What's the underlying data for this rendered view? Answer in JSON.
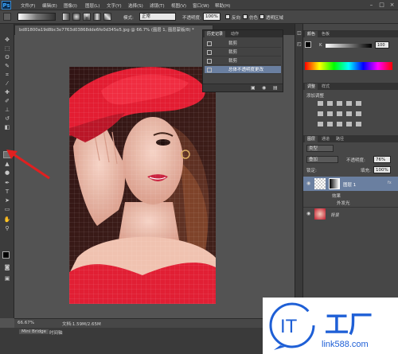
{
  "app": {
    "logo": "Ps"
  },
  "menu": [
    "文件(F)",
    "编辑(E)",
    "图像(I)",
    "图层(L)",
    "文字(Y)",
    "选择(S)",
    "滤镜(T)",
    "视图(V)",
    "窗口(W)",
    "帮助(H)"
  ],
  "window_buttons": [
    "–",
    "□",
    "×"
  ],
  "options_bar": {
    "mode_label": "模式:",
    "mode_value": "正常",
    "opacity_label": "不透明度:",
    "opacity_value": "100%",
    "reverse_label": "反向",
    "dither_label": "仿色",
    "transparency_label": "透明区域"
  },
  "document": {
    "tab_title": "bd81800a19d8bc3e7763d03868dde6fe0d345e5.jpg @ 66.7% (图层 1, 图层蒙版/8) *"
  },
  "history": {
    "tabs": [
      "历史记录",
      "动作"
    ],
    "rows": [
      {
        "label": "裁剪",
        "selected": false
      },
      {
        "label": "裁剪",
        "selected": false
      },
      {
        "label": "裁剪",
        "selected": false
      },
      {
        "label": "总体不透明度更改",
        "selected": true
      }
    ]
  },
  "panels": {
    "color_tabs": [
      "颜色",
      "色板"
    ],
    "color_value": "100",
    "adjust_tabs": [
      "调整",
      "样式"
    ],
    "adjust_title": "添加调整",
    "layers_tabs": [
      "图层",
      "通道",
      "路径"
    ],
    "layer_kind": "类型",
    "blend_mode": "叠加",
    "opacity_label": "不透明度:",
    "opacity_value": "76%",
    "lock_label": "锁定:",
    "fill_label": "填充:",
    "fill_value": "100%",
    "layers": [
      {
        "name": "图层 1",
        "kind": "layer"
      },
      {
        "name": "效果",
        "kind": "effect"
      },
      {
        "name": "外发光",
        "kind": "effect"
      },
      {
        "name": "背景",
        "kind": "background"
      }
    ]
  },
  "status": {
    "zoom": "66.67%",
    "doc_size": "文档:1.59M/2.65M"
  },
  "bottom_tabs": [
    "Mini Bridge",
    "时间轴"
  ],
  "watermark": {
    "logo_letters": "IT",
    "brand": "工厂",
    "url": "link588.com"
  },
  "colors": {
    "accent_arrow": "#e02020",
    "selection": "#6a7fa0",
    "watermark_blue": "#1e5fd6"
  }
}
